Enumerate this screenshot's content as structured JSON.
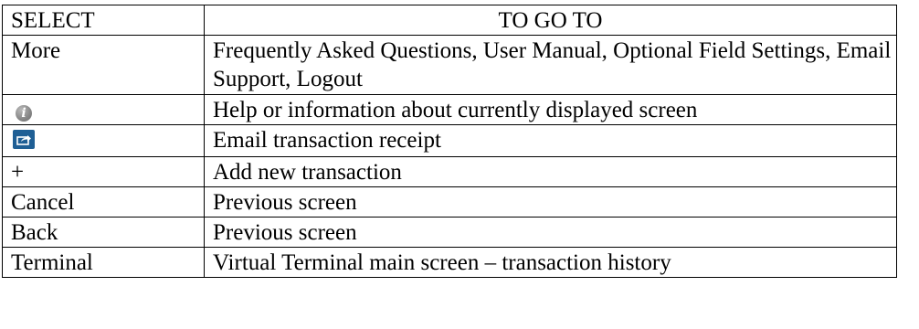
{
  "table": {
    "headers": {
      "select": "SELECT",
      "goto": "TO GO TO"
    },
    "rows": [
      {
        "select": "More",
        "goto": "Frequently Asked Questions, User Manual, Optional Field Settings, Email Support, Logout"
      },
      {
        "select_icon": "info-icon",
        "goto": "Help or information about currently displayed screen"
      },
      {
        "select_icon": "share-icon",
        "goto": "Email transaction receipt"
      },
      {
        "select": "+",
        "goto": "Add new transaction"
      },
      {
        "select": "Cancel",
        "goto": "Previous screen"
      },
      {
        "select": "Back",
        "goto": "Previous screen"
      },
      {
        "select": "Terminal",
        "goto": "Virtual Terminal main screen – transaction history"
      }
    ]
  },
  "colors": {
    "border": "#000000",
    "share_icon_bg": "#1f5f95",
    "info_icon_bg": "#8a8a8a"
  }
}
